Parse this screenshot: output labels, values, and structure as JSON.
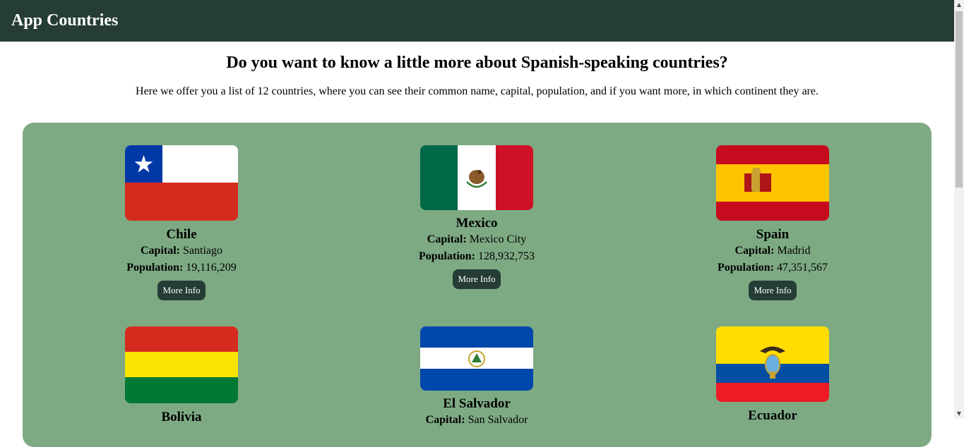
{
  "header": {
    "title": "App Countries"
  },
  "intro": {
    "heading": "Do you want to know a little more about Spanish-speaking countries?",
    "text": "Here we offer you a list of 12 countries, where you can see their common name, capital, population, and if you want more, in which continent they are."
  },
  "labels": {
    "capital": "Capital:",
    "population": "Population:"
  },
  "countries": [
    {
      "name": "Chile",
      "capital": "Santiago",
      "population": "19,116,209",
      "button": "More Info",
      "flag_icon": "chile-flag-icon"
    },
    {
      "name": "Mexico",
      "capital": "Mexico City",
      "population": "128,932,753",
      "button": "More Info",
      "flag_icon": "mexico-flag-icon"
    },
    {
      "name": "Spain",
      "capital": "Madrid",
      "population": "47,351,567",
      "button": "More Info",
      "flag_icon": "spain-flag-icon"
    },
    {
      "name": "Bolivia",
      "flag_icon": "bolivia-flag-icon"
    },
    {
      "name": "El Salvador",
      "capital": "San Salvador",
      "flag_icon": "el-salvador-flag-icon"
    },
    {
      "name": "Ecuador",
      "flag_icon": "ecuador-flag-icon"
    }
  ],
  "colors": {
    "header_bg": "#253d35",
    "panel_bg": "#7eaa83",
    "button_bg": "#253d35"
  }
}
